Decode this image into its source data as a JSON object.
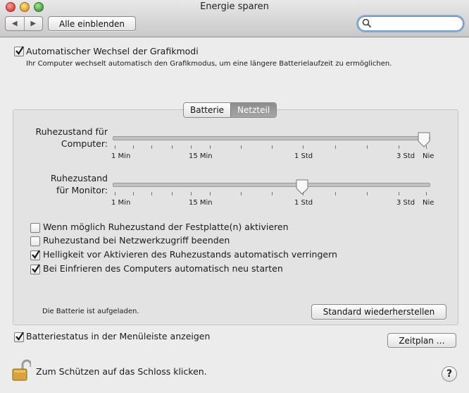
{
  "window": {
    "title": "Energie sparen"
  },
  "toolbar": {
    "show_all_label": "Alle einblenden",
    "search_value": ""
  },
  "graphics": {
    "auto_switch_label": "Automatischer Wechsel der Grafikmodi",
    "auto_switch_checked": true,
    "description": "Ihr Computer wechselt automatisch den Grafikmodus, um eine längere Batterielaufzeit zu ermöglichen."
  },
  "tabs": [
    {
      "label": "Batterie",
      "selected": false
    },
    {
      "label": "Netzteil",
      "selected": true
    }
  ],
  "sliders": {
    "computer": {
      "label": "Ruhezustand für\nComputer:",
      "value": "Nie"
    },
    "monitor": {
      "label": "Ruhezustand\nfür Monitor:",
      "value": "1 Std"
    },
    "tick_labels": [
      "1 Min",
      "15 Min",
      "1 Std",
      "3 Std",
      "Nie"
    ]
  },
  "options": [
    {
      "label": "Wenn möglich Ruhezustand der Festplatte(n) aktivieren",
      "checked": false
    },
    {
      "label": "Ruhezustand bei Netzwerkzugriff beenden",
      "checked": false
    },
    {
      "label": "Helligkeit vor Aktivieren des Ruhezustands automatisch verringern",
      "checked": true
    },
    {
      "label": "Bei Einfrieren des Computers automatisch neu starten",
      "checked": true
    }
  ],
  "battery_status_text": "Die Batterie ist aufgeladen.",
  "restore_defaults_label": "Standard wiederherstellen",
  "menubar_status": {
    "label": "Batteriestatus in der Menüleiste anzeigen",
    "checked": true
  },
  "schedule_label": "Zeitplan …",
  "lock_text": "Zum Schützen auf das Schloss klicken.",
  "help_label": "?",
  "colors": {
    "check": "#1a1a1a",
    "focus_ring": "#7db0ea"
  }
}
